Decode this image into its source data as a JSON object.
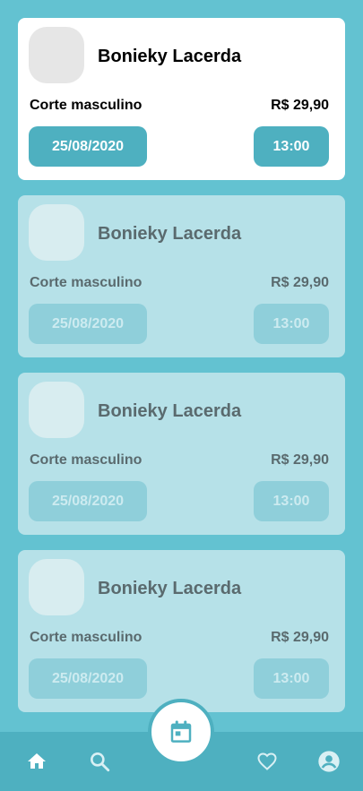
{
  "appointments": [
    {
      "name": "Bonieky Lacerda",
      "service": "Corte masculino",
      "price": "R$ 29,90",
      "date": "25/08/2020",
      "time": "13:00"
    },
    {
      "name": "Bonieky Lacerda",
      "service": "Corte masculino",
      "price": "R$ 29,90",
      "date": "25/08/2020",
      "time": "13:00"
    },
    {
      "name": "Bonieky Lacerda",
      "service": "Corte masculino",
      "price": "R$ 29,90",
      "date": "25/08/2020",
      "time": "13:00"
    },
    {
      "name": "Bonieky Lacerda",
      "service": "Corte masculino",
      "price": "R$ 29,90",
      "date": "25/08/2020",
      "time": "13:00"
    }
  ],
  "tabbar": {
    "items": [
      {
        "icon": "home-icon"
      },
      {
        "icon": "search-icon"
      },
      {
        "icon": "calendar-icon"
      },
      {
        "icon": "heart-icon"
      },
      {
        "icon": "account-icon"
      }
    ]
  },
  "colors": {
    "background": "#63c2d1",
    "accent": "#4eb0c0",
    "card": "#ffffff",
    "card_dim": "#b6e1e8"
  }
}
